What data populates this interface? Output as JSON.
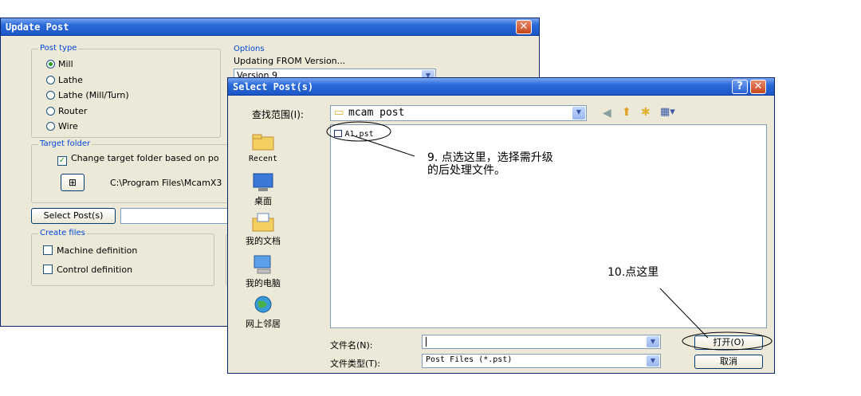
{
  "update_post": {
    "title": "Update Post",
    "post_type": {
      "label": "Post type",
      "options": [
        "Mill",
        "Lathe",
        "Lathe (Mill/Turn)",
        "Router",
        "Wire"
      ],
      "selected": "Mill"
    },
    "options": {
      "label": "Options",
      "updating_from": "Updating FROM Version...",
      "version_value": "Version 9"
    },
    "target_folder": {
      "label": "Target folder",
      "change_checkbox": "Change target folder based on po",
      "path": "C:\\Program Files\\McamX3"
    },
    "select_posts_button": "Select Post(s)",
    "create_files": {
      "label": "Create files",
      "machine_definition": "Machine definition",
      "control_definition": "Control definition"
    }
  },
  "select_post": {
    "title": "Select Post(s)",
    "look_in_label": "查找范围(I):",
    "look_in_value": "mcam post",
    "sidebar": [
      "Recent",
      "桌面",
      "我的文档",
      "我的电脑",
      "网上邻居"
    ],
    "files": [
      "A1.pst"
    ],
    "filename_label": "文件名(N):",
    "filename_value": "",
    "filetype_label": "文件类型(T):",
    "filetype_value": "Post Files (*.pst)",
    "open_button": "打开(O)",
    "cancel_button": "取消"
  },
  "annotations": {
    "note_9_line1": "9. 点选这里，选择需升级",
    "note_9_line2": "的后处理文件。",
    "note_10": "10.点这里"
  },
  "colors": {
    "title_blue": "#1c56c7",
    "window_face": "#ece9d8",
    "group_label": "#0046d5",
    "close_red": "#c6471c"
  }
}
